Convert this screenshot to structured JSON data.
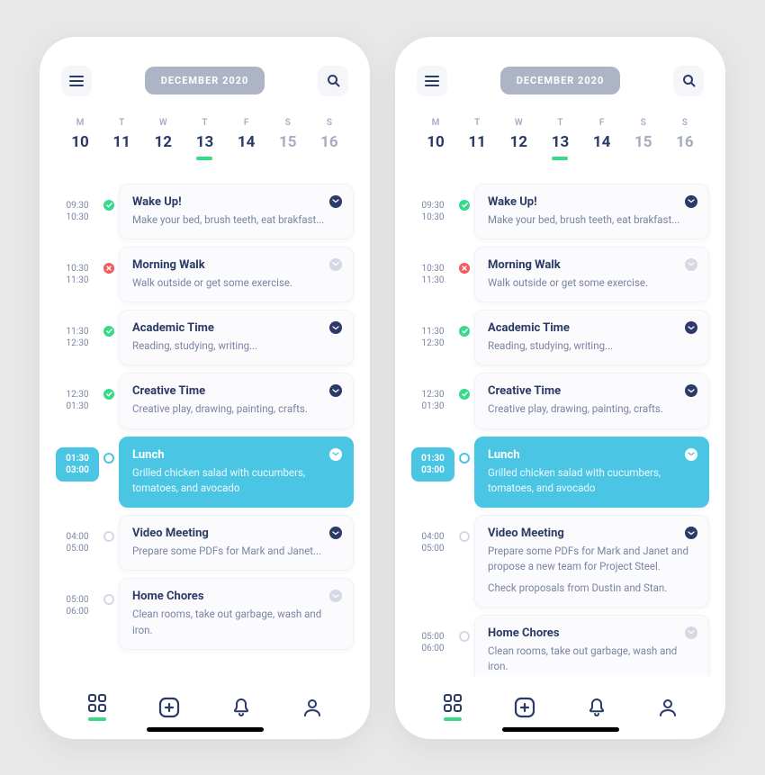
{
  "month_label": "DECEMBER 2020",
  "weekdays": [
    {
      "dow": "M",
      "num": "10",
      "muted": false,
      "selected": false
    },
    {
      "dow": "T",
      "num": "11",
      "muted": false,
      "selected": false
    },
    {
      "dow": "W",
      "num": "12",
      "muted": false,
      "selected": false
    },
    {
      "dow": "T",
      "num": "13",
      "muted": false,
      "selected": true
    },
    {
      "dow": "F",
      "num": "14",
      "muted": false,
      "selected": false
    },
    {
      "dow": "S",
      "num": "15",
      "muted": true,
      "selected": false
    },
    {
      "dow": "S",
      "num": "16",
      "muted": true,
      "selected": false
    }
  ],
  "events": [
    {
      "start": "09:30",
      "end": "10:30",
      "status": "done",
      "title": "Wake Up!",
      "desc": "Make your bed, brush teeth, eat brakfast...",
      "chev": "navy",
      "active": false
    },
    {
      "start": "10:30",
      "end": "11:30",
      "status": "fail",
      "title": "Morning Walk",
      "desc": "Walk outside or get some exercise.",
      "chev": "gray",
      "active": false
    },
    {
      "start": "11:30",
      "end": "12:30",
      "status": "done",
      "title": "Academic Time",
      "desc": "Reading, studying, writing...",
      "chev": "navy",
      "active": false
    },
    {
      "start": "12:30",
      "end": "01:30",
      "status": "done",
      "title": "Creative Time",
      "desc": "Creative play, drawing, painting, crafts.",
      "chev": "navy",
      "active": false
    },
    {
      "start": "01:30",
      "end": "03:00",
      "status": "ring",
      "title": "Lunch",
      "desc": "Grilled chicken salad with cucumbers, tomatoes, and avocado",
      "chev": "white",
      "active": true
    },
    {
      "start": "04:00",
      "end": "05:00",
      "status": "empty",
      "title": "Video Meeting",
      "desc": "Prepare some PDFs for Mark and Janet...",
      "desc_expanded": "Prepare some PDFs for Mark and Janet and propose a new team for Project Steel.",
      "extra": "Check proposals from Dustin and Stan.",
      "chev": "navy",
      "active": false
    },
    {
      "start": "05:00",
      "end": "06:00",
      "status": "empty",
      "title": "Home Chores",
      "desc": "Clean rooms, take out garbage, wash and iron.",
      "chev": "gray",
      "active": false
    }
  ],
  "icons": {
    "menu": "menu-icon",
    "search": "search-icon",
    "grid": "grid-icon",
    "add": "plus-square-icon",
    "bell": "bell-icon",
    "user": "user-icon"
  }
}
